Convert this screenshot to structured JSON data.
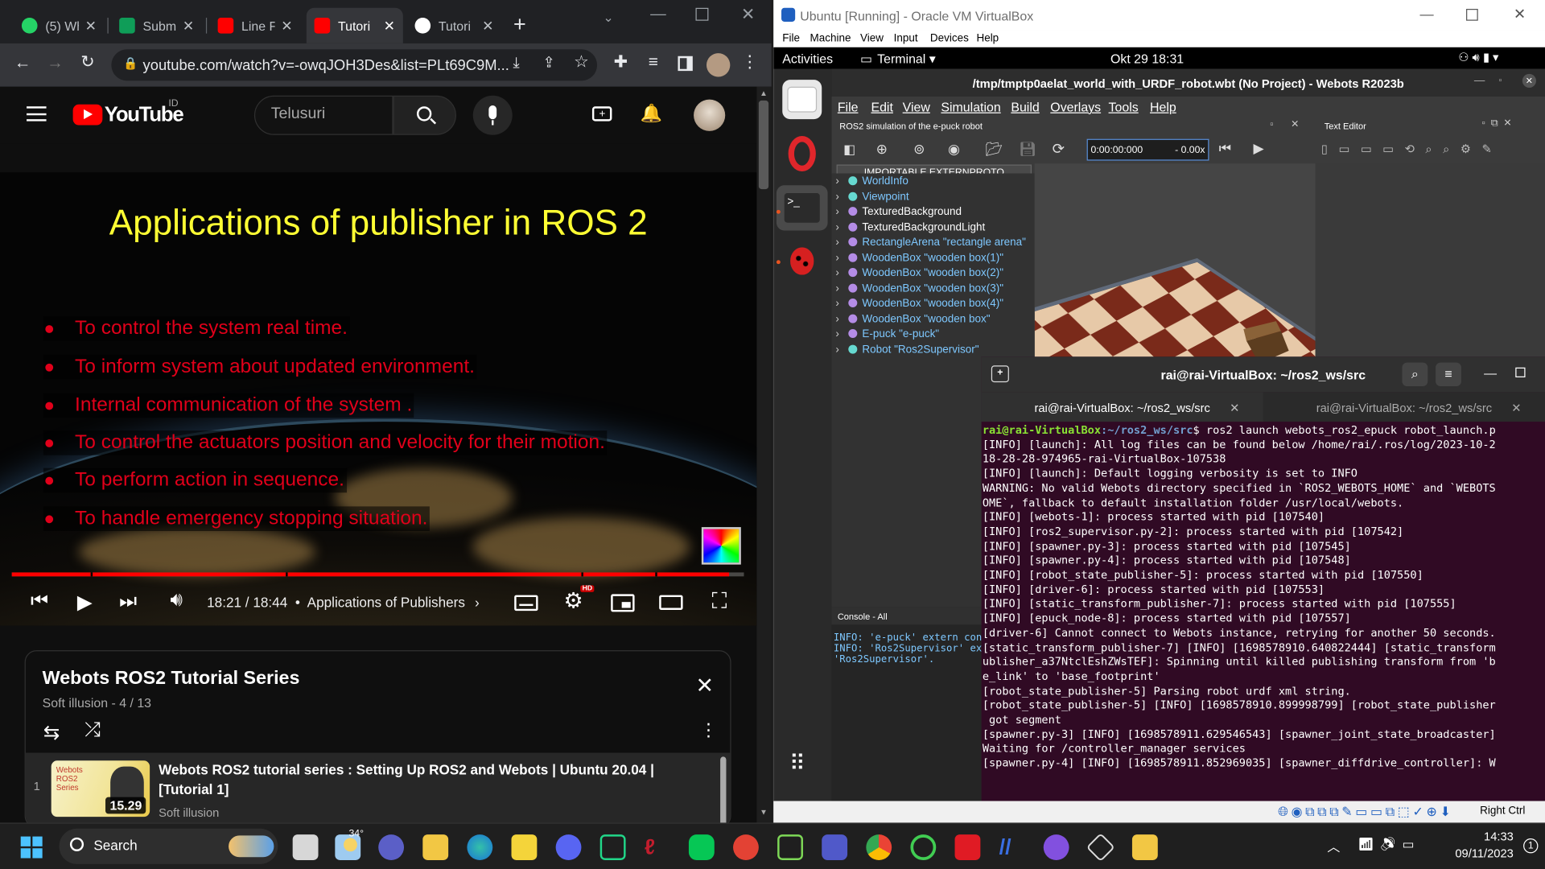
{
  "chrome": {
    "tabs": [
      {
        "label": "(5) Wh",
        "icon": "whatsapp-icon",
        "color": "#25d366"
      },
      {
        "label": "Subm",
        "icon": "sheets-icon",
        "color": "#0f9d58"
      },
      {
        "label": "Line F",
        "icon": "youtube-icon",
        "color": "#ff0000"
      },
      {
        "label": "Tutori",
        "icon": "youtube-icon",
        "color": "#ff0000"
      },
      {
        "label": "Tutori",
        "icon": "github-icon",
        "color": "#ffffff"
      }
    ],
    "url": "youtube.com/watch?v=-owqJOH3Des&list=PLt69C9M..."
  },
  "youtube": {
    "logo_text": "YouTube",
    "region": "ID",
    "search_placeholder": "Telusuri",
    "slide": {
      "title": "Applications of publisher in ROS 2",
      "bullets": [
        "To control the system real time.",
        "To inform system about updated environment.",
        "Internal communication of the system .",
        "To  control the actuators position and velocity for their motion.",
        "To perform action in sequence.",
        "To handle emergency stopping situation."
      ]
    },
    "player": {
      "time": "18:21 / 18:44",
      "chapter": "Applications of Publishers",
      "progress_fraction": 0.9795,
      "hd_badge": "HD"
    },
    "playlist": {
      "title": "Webots ROS2 Tutorial Series",
      "subtitle": "Soft illusion - 4 / 13",
      "item": {
        "index": "1",
        "title": "Webots ROS2 tutorial series : Setting Up ROS2 and Webots | Ubuntu 20.04 | [Tutorial 1]",
        "channel": "Soft illusion",
        "duration": "15.29",
        "thumb_text": "Webots ROS2 Series"
      }
    }
  },
  "vbox": {
    "title": "Ubuntu [Running] - Oracle VM VirtualBox",
    "menu": [
      "File",
      "Machine",
      "View",
      "Input",
      "Devices",
      "Help"
    ],
    "host_key": "Right Ctrl",
    "ubuntu": {
      "activities": "Activities",
      "app": "Terminal",
      "clock": "Okt 29  18:31"
    }
  },
  "webots": {
    "title": "/tmp/tmptp0aelat_world_with_URDF_robot.wbt (No Project) - Webots R2023b",
    "menu": [
      "File",
      "Edit",
      "View",
      "Simulation",
      "Build",
      "Overlays",
      "Tools",
      "Help"
    ],
    "sim_label": "ROS2 simulation of the e-puck robot",
    "text_editor": "Text Editor",
    "time": "0:00:00:000",
    "speed": "-  0.00x",
    "import_btn": "IMPORTABLE EXTERNPROTO",
    "tree": [
      {
        "label": "WorldInfo",
        "color": "#7ec8ff",
        "dot": "#66d9d0"
      },
      {
        "label": "Viewpoint",
        "color": "#7ec8ff",
        "dot": "#66d9d0"
      },
      {
        "label": "TexturedBackground",
        "color": "#ffffff",
        "dot": "#b48ce6"
      },
      {
        "label": "TexturedBackgroundLight",
        "color": "#ffffff",
        "dot": "#b48ce6"
      },
      {
        "label": "RectangleArena \"rectangle arena\"",
        "color": "#7ec8ff",
        "dot": "#b48ce6"
      },
      {
        "label": "WoodenBox \"wooden box(1)\"",
        "color": "#7ec8ff",
        "dot": "#b48ce6"
      },
      {
        "label": "WoodenBox \"wooden box(2)\"",
        "color": "#7ec8ff",
        "dot": "#b48ce6"
      },
      {
        "label": "WoodenBox \"wooden box(3)\"",
        "color": "#7ec8ff",
        "dot": "#b48ce6"
      },
      {
        "label": "WoodenBox \"wooden box(4)\"",
        "color": "#7ec8ff",
        "dot": "#b48ce6"
      },
      {
        "label": "WoodenBox \"wooden box\"",
        "color": "#7ec8ff",
        "dot": "#b48ce6"
      },
      {
        "label": "E-puck \"e-puck\"",
        "color": "#7ec8ff",
        "dot": "#b48ce6"
      },
      {
        "label": "Robot \"Ros2Supervisor\"",
        "color": "#7ec8ff",
        "dot": "#66d9d0"
      }
    ],
    "console": {
      "label": "Console - All",
      "lines": [
        "INFO: 'e-puck' extern con",
        "INFO: 'Ros2Supervisor' ex",
        "'Ros2Supervisor'."
      ]
    }
  },
  "terminal": {
    "title": "rai@rai-VirtualBox: ~/ros2_ws/src",
    "tabs": [
      "rai@rai-VirtualBox: ~/ros2_ws/src",
      "rai@rai-VirtualBox: ~/ros2_ws/src"
    ],
    "prompt_user": "rai@rai-VirtualBox",
    "prompt_path": ":~/ros2_ws/src",
    "command": "$ ros2 launch webots_ros2_epuck robot_launch.p",
    "lines": [
      "[INFO] [launch]: All log files can be found below /home/rai/.ros/log/2023-10-2",
      "18-28-28-974965-rai-VirtualBox-107538",
      "[INFO] [launch]: Default logging verbosity is set to INFO",
      "WARNING: No valid Webots directory specified in `ROS2_WEBOTS_HOME` and `WEBOTS",
      "OME`, fallback to default installation folder /usr/local/webots.",
      "[INFO] [webots-1]: process started with pid [107540]",
      "[INFO] [ros2_supervisor.py-2]: process started with pid [107542]",
      "[INFO] [spawner.py-3]: process started with pid [107545]",
      "[INFO] [spawner.py-4]: process started with pid [107548]",
      "[INFO] [robot_state_publisher-5]: process started with pid [107550]",
      "[INFO] [driver-6]: process started with pid [107553]",
      "[INFO] [static_transform_publisher-7]: process started with pid [107555]",
      "[INFO] [epuck_node-8]: process started with pid [107557]",
      "[driver-6] Cannot connect to Webots instance, retrying for another 50 seconds.",
      "[static_transform_publisher-7] [INFO] [1698578910.640822444] [static_transform",
      "ublisher_a37NtclEshZWsTEF]: Spinning until killed publishing transform from 'b",
      "e_link' to 'base_footprint'",
      "[robot_state_publisher-5] Parsing robot urdf xml string.",
      "[robot_state_publisher-5] [INFO] [1698578910.899998799] [robot_state_publisher",
      " got segment",
      "[spawner.py-3] [INFO] [1698578911.629546543] [spawner_joint_state_broadcaster]",
      "Waiting for /controller_manager services",
      "[spawner.py-4] [INFO] [1698578911.852969035] [spawner_diffdrive_controller]: W"
    ]
  },
  "taskbar": {
    "search": "Search",
    "weather": "34°",
    "time": "14:33",
    "date": "09/11/2023",
    "notifications": "1"
  }
}
